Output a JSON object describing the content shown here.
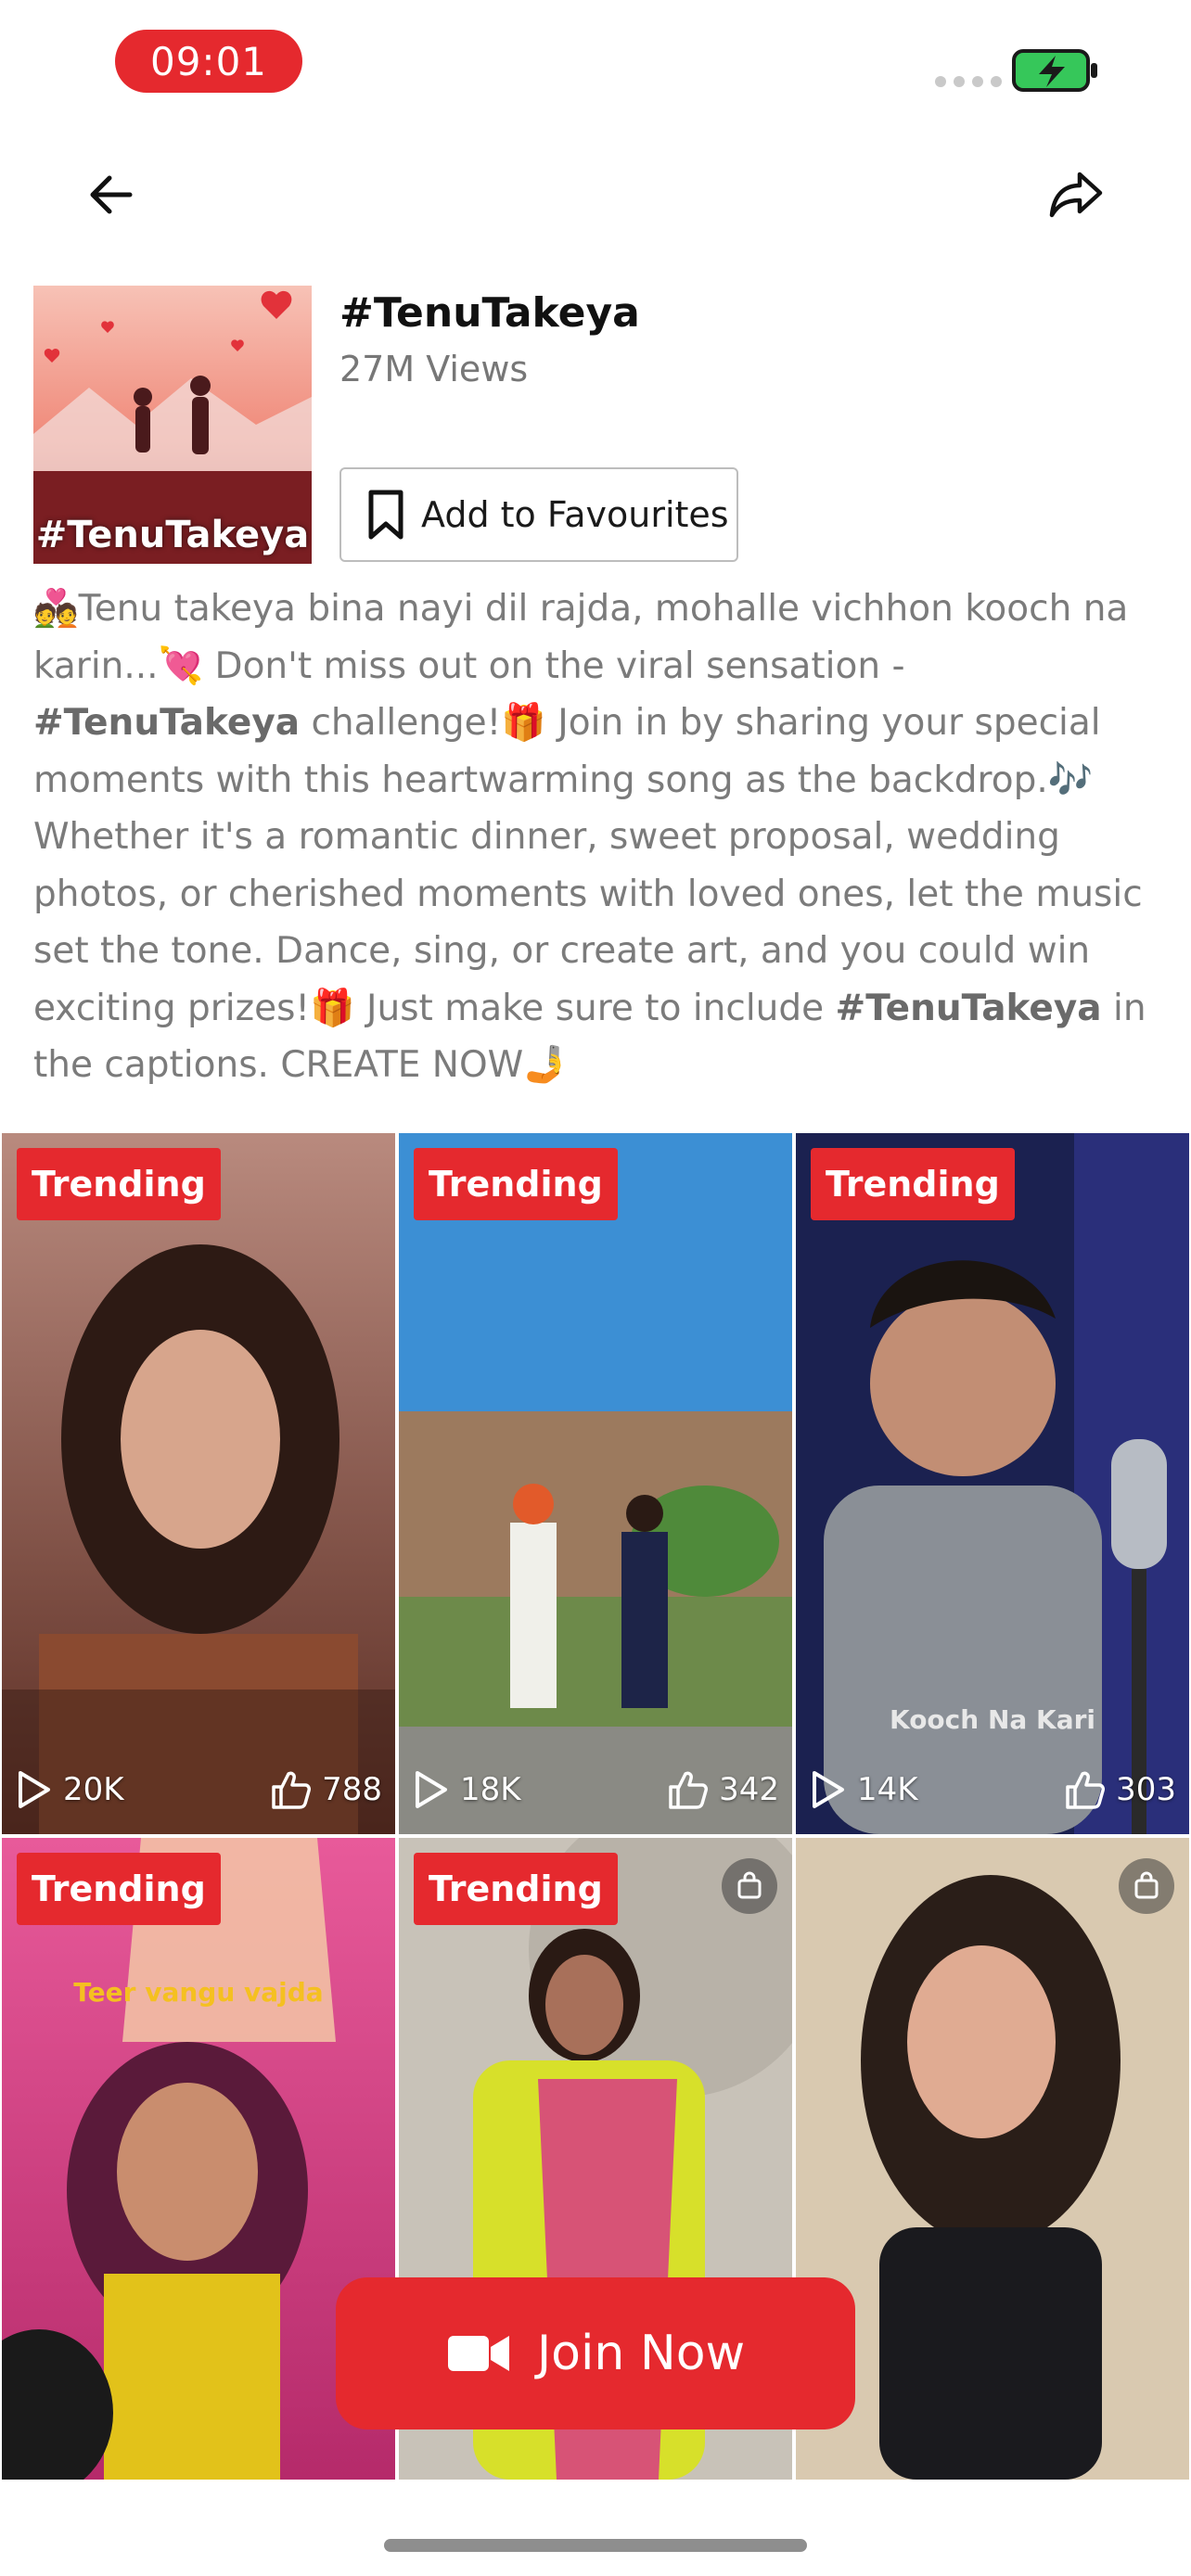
{
  "status_bar": {
    "time": "09:01"
  },
  "header": {
    "title": "#TenuTakeya",
    "views": "27M Views",
    "cover_text": "#TenuTakeya",
    "favourite_label": "Add to Favourites"
  },
  "description": {
    "p1": "Tenu takeya bina nayi dil rajda, mohalle vichhon kooch na karin...",
    "p2": " Don't miss out on the viral sensation - ",
    "tag1": "#TenuTakeya",
    "p3": " challenge!",
    "p4": " Join in by sharing your special moments with this heartwarming song as the backdrop.",
    "p5": " Whether it's a romantic dinner, sweet proposal, wedding photos, or cherished moments with loved ones, let the music set the tone. Dance, sing, or create art, and you could win exciting prizes!",
    "p6": " Just make sure to include ",
    "tag2": "#TenuTakeya",
    "p7": " in the captions. CREATE NOW",
    "emoji_couple": "💑",
    "emoji_heart": "💘",
    "emoji_gift": "🎁",
    "emoji_notes": "🎶",
    "emoji_selfie": "🤳"
  },
  "videos": [
    {
      "badge": "Trending",
      "plays": "20K",
      "likes": "788"
    },
    {
      "badge": "Trending",
      "plays": "18K",
      "likes": "342"
    },
    {
      "badge": "Trending",
      "plays": "14K",
      "likes": "303",
      "overlay": "Kooch Na Kari"
    },
    {
      "badge": "Trending",
      "overlay": "Teer vangu vajda"
    },
    {
      "badge": "Trending"
    },
    {}
  ],
  "join_button": {
    "label": "Join Now"
  },
  "colors": {
    "accent": "#e5292e",
    "battery": "#36c75a"
  }
}
